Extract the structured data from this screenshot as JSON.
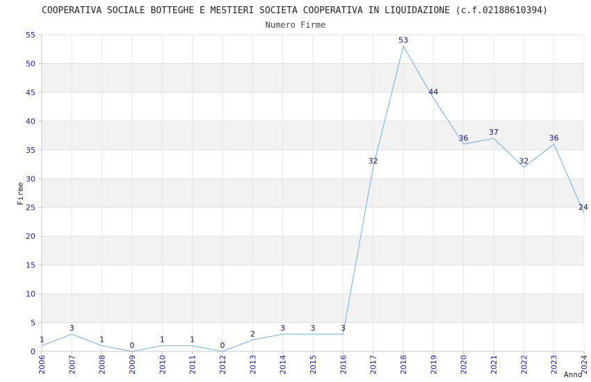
{
  "chart_data": {
    "type": "line",
    "title": "COOPERATIVA SOCIALE BOTTEGHE E MESTIERI SOCIETA COOPERATIVA IN LIQUIDAZIONE (c.f.02188610394)",
    "subtitle": "Numero Firme",
    "xlabel": "Anno",
    "ylabel": "Firme",
    "x": [
      "2006",
      "2007",
      "2008",
      "2009",
      "2010",
      "2011",
      "2012",
      "2013",
      "2014",
      "2015",
      "2016",
      "2017",
      "2018",
      "2019",
      "2020",
      "2021",
      "2022",
      "2023",
      "2024"
    ],
    "series": [
      {
        "values": [
          1,
          3,
          1,
          0,
          1,
          1,
          0,
          2,
          3,
          3,
          3,
          32,
          53,
          44,
          36,
          37,
          32,
          36,
          24
        ]
      }
    ],
    "ylim": [
      0,
      55
    ],
    "yticks": [
      0,
      5,
      10,
      15,
      20,
      25,
      30,
      35,
      40,
      45,
      50,
      55
    ],
    "grid": true,
    "line_color": "#6aaee8",
    "band_color": "#f2f2f2",
    "tick_color": "#1a1aa6"
  }
}
